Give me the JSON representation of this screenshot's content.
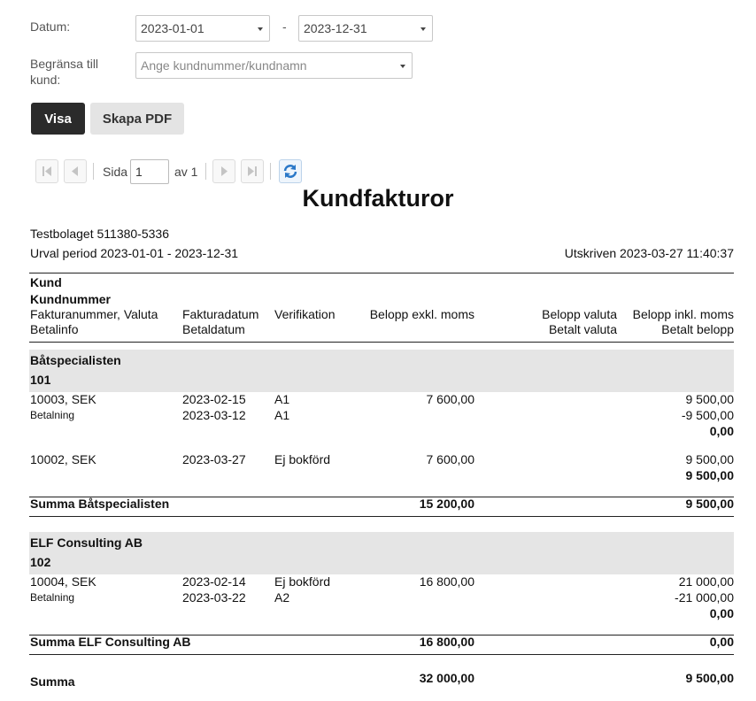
{
  "filters": {
    "datum_label": "Datum:",
    "from_date": "2023-01-01",
    "dash": "-",
    "to_date": "2023-12-31",
    "kund_label_line1": "Begränsa till",
    "kund_label_line2": "kund:",
    "kund_placeholder": "Ange kundnummer/kundnamn"
  },
  "actions": {
    "visa": "Visa",
    "pdf": "Skapa PDF"
  },
  "pager": {
    "sida": "Sida",
    "page": "1",
    "av": "av 1"
  },
  "report": {
    "title": "Kundfakturor",
    "company": "Testbolaget 511380-5336",
    "period": "Urval period 2023-01-01 - 2023-12-31",
    "printed": "Utskriven 2023-03-27 11:40:37",
    "headers": {
      "kund": "Kund",
      "kundnummer": "Kundnummer",
      "faktnr": "Fakturanummer, Valuta",
      "betalinfo": "Betalinfo",
      "fakturadatum": "Fakturadatum",
      "betaldatum": "Betaldatum",
      "verifikation": "Verifikation",
      "belopp_exkl": "Belopp exkl. moms",
      "belopp_valuta": "Belopp valuta",
      "betalt_valuta": "Betalt valuta",
      "belopp_inkl": "Belopp inkl. moms",
      "betalt_belopp": "Betalt belopp"
    },
    "customers": [
      {
        "name": "Båtspecialisten",
        "number": "101",
        "invoices": [
          {
            "nr": "10003, SEK",
            "date": "2023-02-15",
            "ver": "A1",
            "exkl": "7 600,00",
            "inkl": "9 500,00",
            "pay_label": "Betalning",
            "pay_date": "2023-03-12",
            "pay_ver": "A1",
            "pay_amount": "-9 500,00",
            "rest": "0,00"
          },
          {
            "nr": "10002, SEK",
            "date": "2023-03-27",
            "ver": "Ej bokförd",
            "exkl": "7 600,00",
            "inkl": "9 500,00",
            "rest": "9 500,00"
          }
        ],
        "sum_label": "Summa Båtspecialisten",
        "sum_exkl": "15 200,00",
        "sum_inkl": "9 500,00"
      },
      {
        "name": "ELF Consulting AB",
        "number": "102",
        "invoices": [
          {
            "nr": "10004, SEK",
            "date": "2023-02-14",
            "ver": "Ej bokförd",
            "exkl": "16 800,00",
            "inkl": "21 000,00",
            "pay_label": "Betalning",
            "pay_date": "2023-03-22",
            "pay_ver": "A2",
            "pay_amount": "-21 000,00",
            "rest": "0,00"
          }
        ],
        "sum_label": "Summa ELF Consulting AB",
        "sum_exkl": "16 800,00",
        "sum_inkl": "0,00"
      }
    ],
    "total_label": "Summa",
    "total_exkl": "32 000,00",
    "total_inkl": "9 500,00"
  }
}
